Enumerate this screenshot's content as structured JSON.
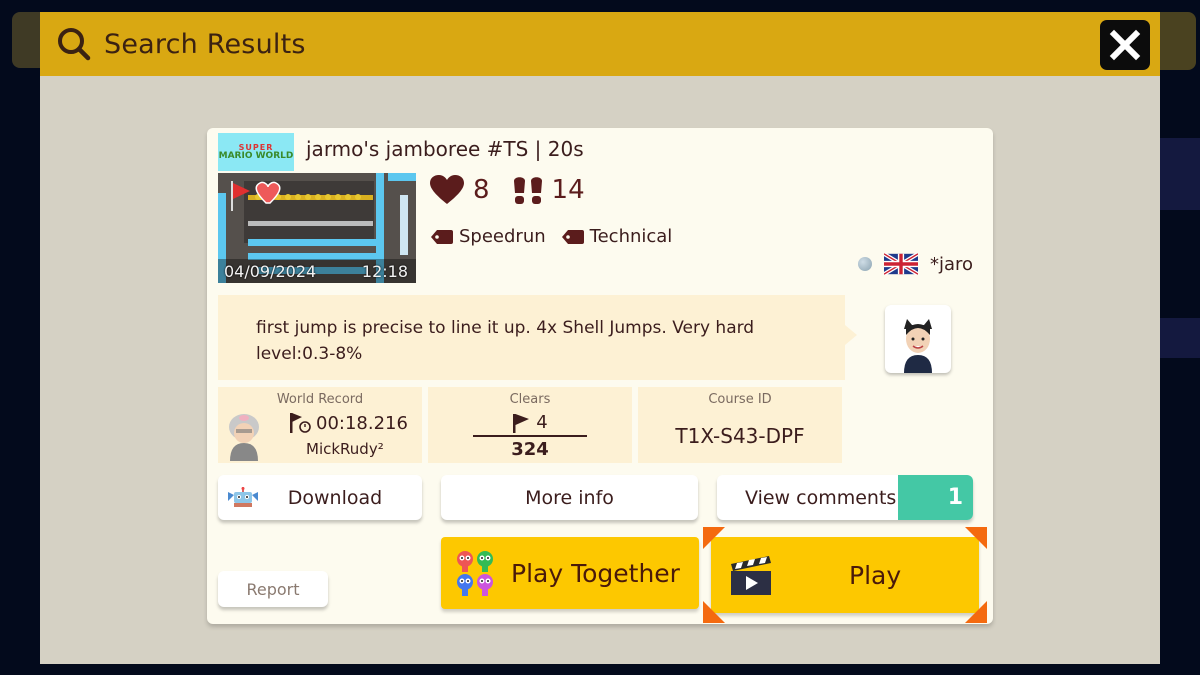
{
  "header": {
    "title": "Search Results",
    "search_icon": "search-icon",
    "close_icon": "close-icon"
  },
  "course": {
    "game_style": {
      "line1": "SUPER",
      "line2": "MARIO WORLD"
    },
    "title": "jarmo's jamboree #TS  |  20s",
    "upload_date": "04/09/2024",
    "upload_time": "12:18",
    "likes": "8",
    "plays": "14",
    "tags": [
      "Speedrun",
      "Technical"
    ],
    "maker": {
      "name": "*jaro",
      "country_flag": "uk-flag-icon"
    },
    "description": "first jump is precise to line it up. 4x Shell Jumps. Very hard level:0.3-8%",
    "world_record": {
      "label": "World Record",
      "time": "00:18.216",
      "holder": "MickRudy²"
    },
    "clears": {
      "label": "Clears",
      "cleared": "4",
      "attempts": "324"
    },
    "course_id": {
      "label": "Course ID",
      "value": "T1X-S43-DPF"
    }
  },
  "buttons": {
    "download": "Download",
    "more_info": "More info",
    "view_comments": "View comments",
    "comment_count": "1",
    "report": "Report",
    "play_together": "Play Together",
    "play": "Play"
  },
  "colors": {
    "header_bg": "#d9a812",
    "card_bg": "#fdfbef",
    "accent_yellow": "#fdc800",
    "comments_teal": "#44c8a5",
    "selection_orange": "#f46a0f",
    "text_dark": "#3b1d1d"
  }
}
